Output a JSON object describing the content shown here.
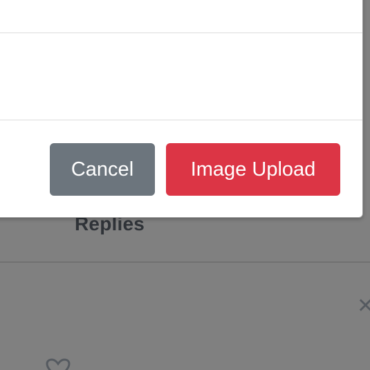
{
  "background": {
    "section_title": "Replies",
    "close_icon": "close-icon",
    "heart_icon": "heart-icon"
  },
  "modal": {
    "footer": {
      "cancel_label": "Cancel",
      "upload_label": "Image Upload"
    }
  },
  "colors": {
    "overlay": "#808080",
    "cancel_button": "#6c757d",
    "upload_button": "#dc3545",
    "modal_background": "#ffffff"
  }
}
